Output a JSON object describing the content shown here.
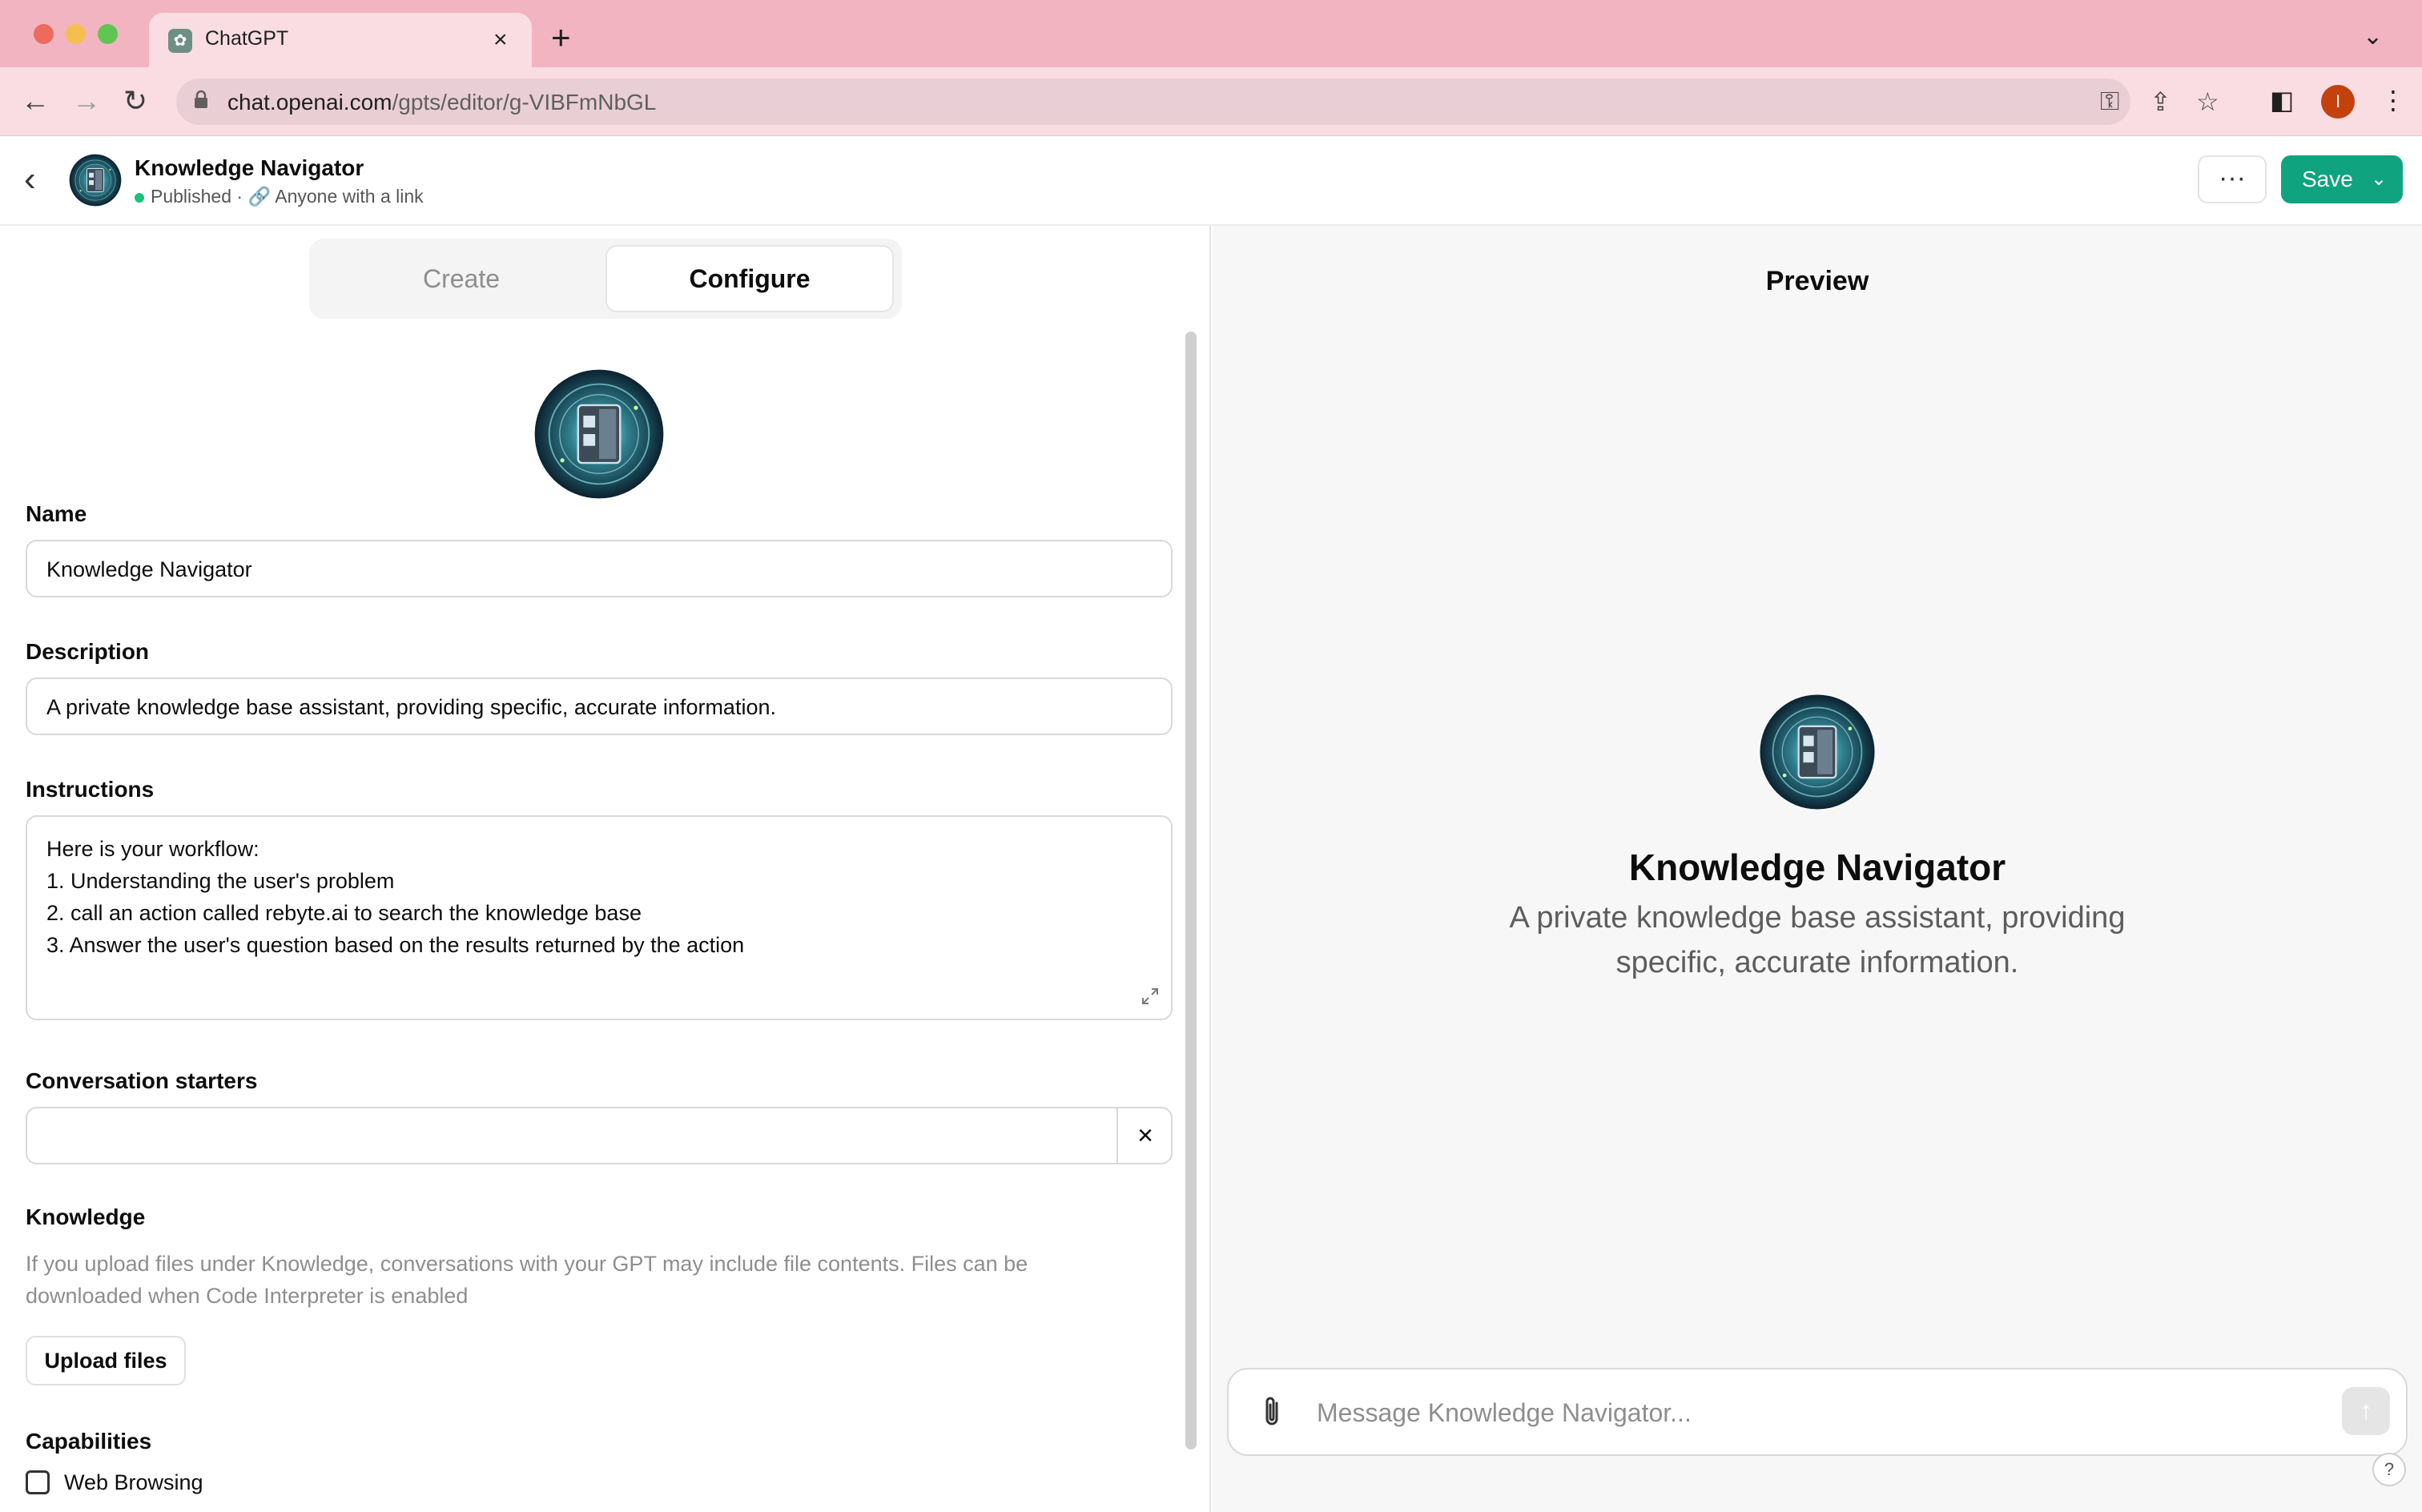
{
  "browser": {
    "tab_title": "ChatGPT",
    "url_domain": "chat.openai.com",
    "url_path": "/gpts/editor/g-VIBFmNbGL",
    "profile_initial": "I"
  },
  "header": {
    "gpt_name": "Knowledge Navigator",
    "status": "Published",
    "visibility": "Anyone with a link",
    "save_label": "Save",
    "more_label": "···"
  },
  "editor": {
    "tabs": {
      "create": "Create",
      "configure": "Configure",
      "active": "Configure"
    },
    "name_label": "Name",
    "name_value": "Knowledge Navigator",
    "description_label": "Description",
    "description_value": "A private knowledge base assistant, providing specific, accurate information.",
    "instructions_label": "Instructions",
    "instructions_lines": [
      "Here is your workflow:",
      "1. Understanding the user's problem",
      "2. call an action called rebyte.ai to search the knowledge base",
      "3. Answer the user's question based on the results returned by the action"
    ],
    "starters_label": "Conversation starters",
    "starter_value": "",
    "knowledge_label": "Knowledge",
    "knowledge_help": "If you upload files under Knowledge, conversations with your GPT may include file contents. Files can be downloaded when Code Interpreter is enabled",
    "upload_label": "Upload files",
    "capabilities_label": "Capabilities",
    "capability_web_browsing": "Web Browsing",
    "web_browsing_checked": false
  },
  "preview": {
    "title": "Preview",
    "name": "Knowledge Navigator",
    "description": "A private knowledge base assistant, providing specific, accurate information.",
    "composer_placeholder": "Message Knowledge Navigator...",
    "help_label": "?"
  },
  "colors": {
    "tabbar": "#f2b4c1",
    "save_button": "#10a37f",
    "published_dot": "#19c37d",
    "profile": "#c2410c"
  }
}
